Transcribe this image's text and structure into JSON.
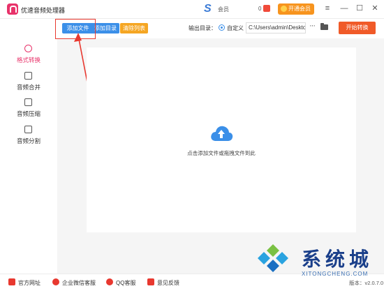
{
  "app": {
    "title": "优速音频处理器"
  },
  "header": {
    "brand_glyph": "S",
    "member_text": "会员",
    "coupon_count": "0",
    "vip_label": "开通会员",
    "menu_icon": "≡",
    "minimize_icon": "—",
    "maximize_icon": "☐",
    "close_icon": "✕"
  },
  "toolbar": {
    "add_file_label": "添加文件",
    "add_dir_label": "添加目录",
    "clear_label": "清除列表",
    "output_dir_label": "输出目录：",
    "custom_label": "自定义",
    "output_path": "C:\\Users\\admin\\Deskto",
    "more_label": "···",
    "start_label": "开始转换"
  },
  "sidebar": {
    "items": [
      {
        "label": "格式转换",
        "icon": "refresh-icon",
        "active": true
      },
      {
        "label": "音频合并",
        "icon": "merge-icon",
        "active": false
      },
      {
        "label": "音频压缩",
        "icon": "compress-icon",
        "active": false
      },
      {
        "label": "音频分割",
        "icon": "split-icon",
        "active": false
      }
    ]
  },
  "main": {
    "drop_hint": "点击添加文件或拖拽文件到此"
  },
  "footer": {
    "website": "官方网址",
    "wechat": "企业微信客服",
    "qq": "QQ客服",
    "feedback": "意见反馈",
    "version": "版本：v2.0.7.0"
  },
  "watermark": {
    "main": "系统城",
    "sub": "XITONGCHENG.COM"
  },
  "colors": {
    "accent": "#e8336a",
    "blue": "#3b8fe8",
    "orange": "#f5a623",
    "start": "#f05a28",
    "highlight": "#e8382f"
  }
}
